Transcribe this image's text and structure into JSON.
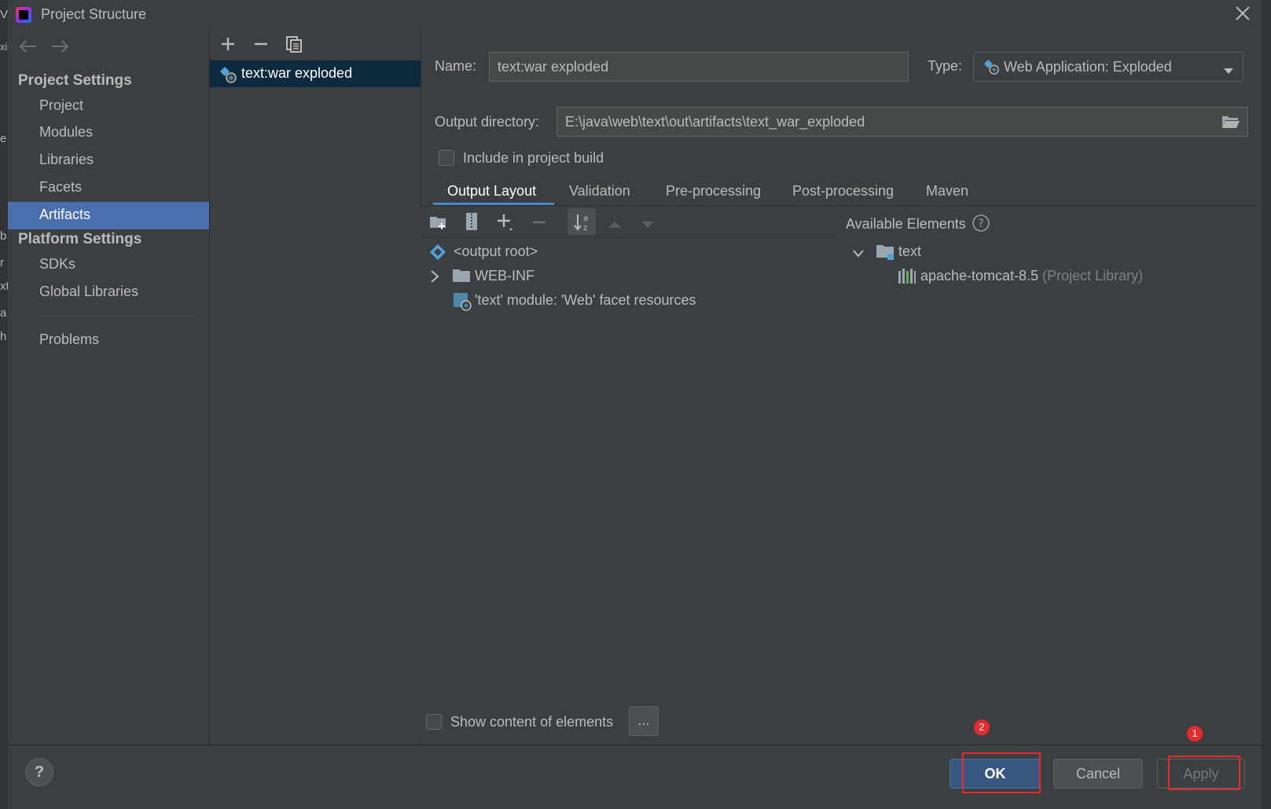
{
  "window": {
    "title": "Project Structure"
  },
  "edge_fragments": [
    "V",
    "xi",
    "e",
    "b",
    "r",
    "xt",
    "a",
    "h"
  ],
  "nav": {
    "back_icon": "arrow-left-icon",
    "forward_icon": "arrow-right-icon",
    "project_settings_label": "Project Settings",
    "project_settings_items": [
      "Project",
      "Modules",
      "Libraries",
      "Facets",
      "Artifacts"
    ],
    "selected": "Artifacts",
    "platform_settings_label": "Platform Settings",
    "platform_settings_items": [
      "SDKs",
      "Global Libraries"
    ],
    "problems_label": "Problems"
  },
  "artifact_list": {
    "items": [
      "text:war exploded"
    ]
  },
  "form": {
    "name_label": "Name:",
    "name_value": "text:war exploded",
    "type_label": "Type:",
    "type_value": "Web Application: Exploded",
    "output_dir_label": "Output directory:",
    "output_dir_value": "E:\\java\\web\\text\\out\\artifacts\\text_war_exploded",
    "include_build_label": "Include in project build",
    "include_build_checked": false
  },
  "tabs": [
    "Output Layout",
    "Validation",
    "Pre-processing",
    "Post-processing",
    "Maven"
  ],
  "active_tab": "Output Layout",
  "output_tree": {
    "root": "<output root>",
    "children": [
      "WEB-INF",
      "'text' module: 'Web' facet resources"
    ]
  },
  "available": {
    "label": "Available Elements",
    "root": "text",
    "library_name": "apache-tomcat-8.5",
    "library_suffix": "(Project Library)"
  },
  "show_content_label": "Show content of elements",
  "more_label": "...",
  "buttons": {
    "help": "?",
    "ok": "OK",
    "cancel": "Cancel",
    "apply": "Apply"
  },
  "annotations": {
    "apply_badge": "1",
    "ok_badge": "2"
  },
  "colors": {
    "background": "#3c3f41",
    "selection": "#4b6eaf",
    "list_selection": "#0d293e",
    "accent_tab": "#4a88c7",
    "ok_button": "#365880",
    "annotation_red": "#e8292d"
  }
}
